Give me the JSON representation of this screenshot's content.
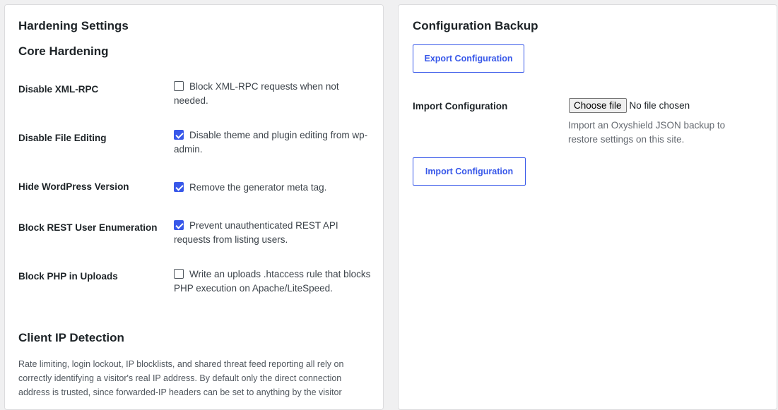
{
  "hardening": {
    "title": "Hardening Settings",
    "core_title": "Core Hardening",
    "settings": [
      {
        "label": "Disable XML-RPC",
        "checked": false,
        "description": "Block XML-RPC requests when not needed."
      },
      {
        "label": "Disable File Editing",
        "checked": true,
        "description": "Disable theme and plugin editing from wp-admin."
      },
      {
        "label": "Hide WordPress Version",
        "checked": true,
        "description": "Remove the generator meta tag."
      },
      {
        "label": "Block REST User Enumeration",
        "checked": true,
        "description": "Prevent unauthenticated REST API requests from listing users."
      },
      {
        "label": "Block PHP in Uploads",
        "checked": false,
        "description": "Write an uploads .htaccess rule that blocks PHP execution on Apache/LiteSpeed."
      }
    ],
    "client_ip_title": "Client IP Detection",
    "client_ip_description": "Rate limiting, login lockout, IP blocklists, and shared threat feed reporting all rely on correctly identifying a visitor's real IP address. By default only the direct connection address is trusted, since forwarded-IP headers can be set to anything by the visitor"
  },
  "backup": {
    "title": "Configuration Backup",
    "export_button": "Export Configuration",
    "import_label": "Import Configuration",
    "choose_file_button": "Choose file",
    "file_status": "No file chosen",
    "import_help": "Import an Oxyshield JSON backup to restore settings on this site.",
    "import_button": "Import Configuration"
  },
  "colors": {
    "accent": "#3858e9",
    "background": "#f0f0f1",
    "panel": "#ffffff"
  }
}
